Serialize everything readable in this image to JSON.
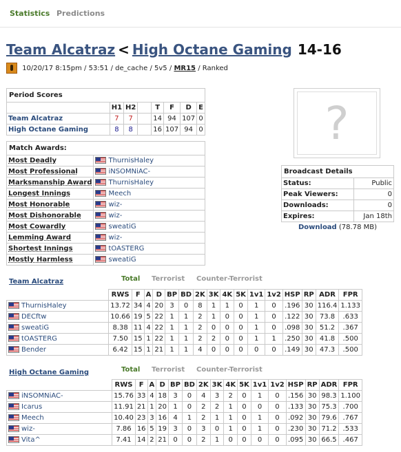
{
  "tabs": {
    "statistics": "Statistics",
    "predictions": "Predictions"
  },
  "match": {
    "team1": "Team Alcatraz",
    "separator": "<",
    "team2": "High Octane Gaming",
    "score": "14-16",
    "date": "10/20/17 8:15pm",
    "sep": "/",
    "duration": "53:51",
    "map": "de_cache",
    "format": "5v5",
    "mr": "MR15",
    "status": "Ranked"
  },
  "period_scores": {
    "title": "Period Scores",
    "headers": [
      "H1",
      "H2",
      "T",
      "F",
      "D",
      "E"
    ],
    "rows": [
      {
        "team": "Team Alcatraz",
        "h1": "7",
        "h2": "7",
        "t": "14",
        "f": "94",
        "d": "107",
        "e": "0"
      },
      {
        "team": "High Octane Gaming",
        "h1": "8",
        "h2": "8",
        "t": "16",
        "f": "107",
        "d": "94",
        "e": "0"
      }
    ]
  },
  "awards": {
    "title": "Match Awards:",
    "items": [
      {
        "award": "Most Deadly",
        "player": "ThurnisHaley"
      },
      {
        "award": "Most Professional",
        "player": "iNSOMNiAC-"
      },
      {
        "award": "Marksmanship Award",
        "player": "ThurnisHaley"
      },
      {
        "award": "Longest Innings",
        "player": "Meech"
      },
      {
        "award": "Most Honorable",
        "player": "wiz-"
      },
      {
        "award": "Most Dishonorable",
        "player": "wiz-"
      },
      {
        "award": "Most Cowardly",
        "player": "sweatiG"
      },
      {
        "award": "Lemming Award",
        "player": "wiz-"
      },
      {
        "award": "Shortest Innings",
        "player": "tOASTERG"
      },
      {
        "award": "Mostly Harmless",
        "player": "sweatiG"
      }
    ]
  },
  "preview": {
    "placeholder": "?"
  },
  "broadcast": {
    "title": "Broadcast Details",
    "rows": [
      {
        "k": "Status:",
        "v": "Public"
      },
      {
        "k": "Peak Viewers:",
        "v": "0"
      },
      {
        "k": "Downloads:",
        "v": "0"
      },
      {
        "k": "Expires:",
        "v": "Jan 18th"
      }
    ],
    "download_label": "Download",
    "download_size": "(78.78 MB)"
  },
  "stat_tabs": {
    "total": "Total",
    "terrorist": "Terrorist",
    "ct": "Counter-Terrorist"
  },
  "stat_headers": [
    "RWS",
    "F",
    "A",
    "D",
    "BP",
    "BD",
    "2K",
    "3K",
    "4K",
    "5K",
    "1v1",
    "1v2",
    "HSP",
    "RP",
    "ADR",
    "FPR"
  ],
  "teams": [
    {
      "name": "Team Alcatraz",
      "players": [
        {
          "name": "ThurnisHaley",
          "stats": [
            "13.72",
            "34",
            "4",
            "20",
            "3",
            "0",
            "8",
            "1",
            "1",
            "0",
            "1",
            "0",
            ".196",
            "30",
            "116.4",
            "1.133"
          ]
        },
        {
          "name": "DECftw",
          "stats": [
            "10.66",
            "19",
            "5",
            "22",
            "1",
            "1",
            "2",
            "1",
            "0",
            "0",
            "1",
            "0",
            ".122",
            "30",
            "73.8",
            ".633"
          ]
        },
        {
          "name": "sweatiG",
          "stats": [
            "8.38",
            "11",
            "4",
            "22",
            "1",
            "1",
            "2",
            "0",
            "0",
            "0",
            "1",
            "0",
            ".098",
            "30",
            "51.2",
            ".367"
          ]
        },
        {
          "name": "tOASTERG",
          "stats": [
            "7.50",
            "15",
            "1",
            "22",
            "1",
            "1",
            "2",
            "2",
            "0",
            "0",
            "1",
            "1",
            ".250",
            "30",
            "41.8",
            ".500"
          ]
        },
        {
          "name": "Bender",
          "stats": [
            "6.42",
            "15",
            "1",
            "21",
            "1",
            "1",
            "4",
            "0",
            "0",
            "0",
            "0",
            "0",
            ".149",
            "30",
            "47.3",
            ".500"
          ]
        }
      ]
    },
    {
      "name": "High Octane Gaming",
      "players": [
        {
          "name": "iNSOMNiAC-",
          "stats": [
            "15.76",
            "33",
            "4",
            "18",
            "3",
            "0",
            "4",
            "3",
            "2",
            "0",
            "1",
            "0",
            ".156",
            "30",
            "98.3",
            "1.100"
          ]
        },
        {
          "name": "Icarus",
          "stats": [
            "11.91",
            "21",
            "1",
            "20",
            "1",
            "0",
            "2",
            "2",
            "1",
            "0",
            "0",
            "0",
            ".133",
            "30",
            "75.3",
            ".700"
          ]
        },
        {
          "name": "Meech",
          "stats": [
            "10.40",
            "23",
            "3",
            "16",
            "4",
            "1",
            "2",
            "1",
            "1",
            "0",
            "1",
            "0",
            ".092",
            "30",
            "79.6",
            ".767"
          ]
        },
        {
          "name": "wiz-",
          "stats": [
            "7.86",
            "16",
            "5",
            "19",
            "3",
            "0",
            "3",
            "0",
            "1",
            "0",
            "1",
            "0",
            ".230",
            "30",
            "71.2",
            ".533"
          ]
        },
        {
          "name": "Vita^",
          "stats": [
            "7.41",
            "14",
            "2",
            "21",
            "0",
            "0",
            "2",
            "1",
            "0",
            "0",
            "0",
            "0",
            ".095",
            "30",
            "66.5",
            ".467"
          ]
        }
      ]
    }
  ]
}
